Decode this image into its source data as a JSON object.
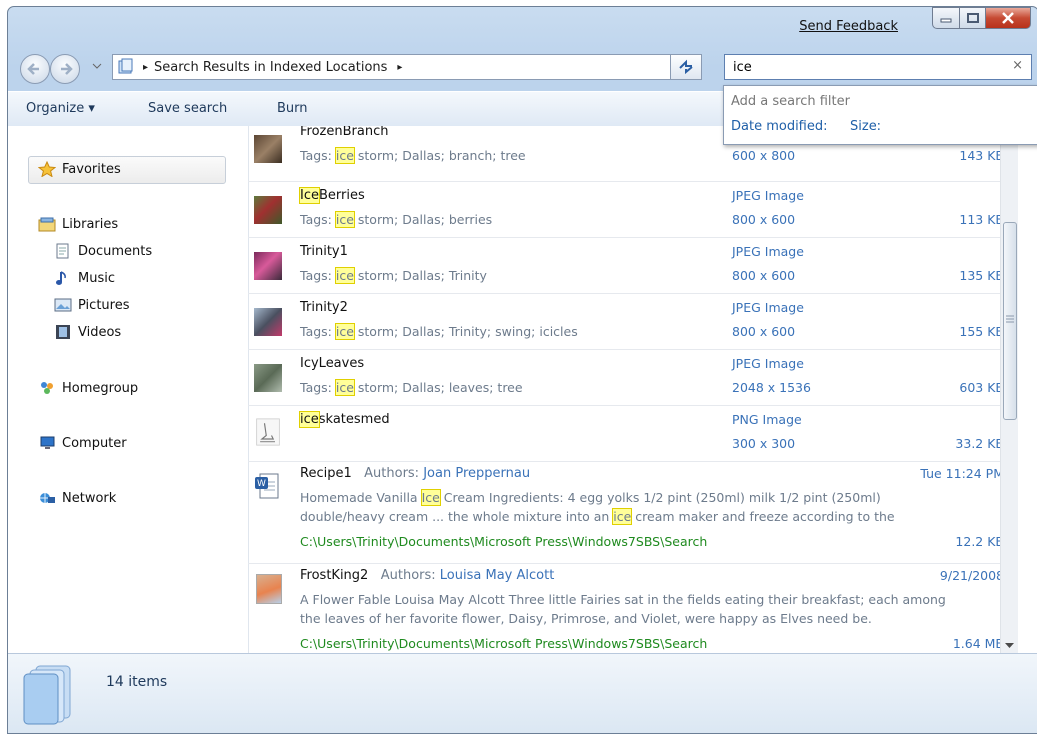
{
  "titlebar": {
    "send_feedback": "Send Feedback",
    "caption_icons": [
      "minimize-icon",
      "maximize-icon",
      "close-icon"
    ]
  },
  "address": {
    "path_parts": [
      "Search Results in Indexed Locations"
    ],
    "separator": "▸",
    "refresh_icon": "refresh-icon"
  },
  "search": {
    "value": "ice",
    "clear": "×"
  },
  "search_dropdown": {
    "heading": "Add a search filter",
    "filters": [
      "Date modified:",
      "Size:"
    ]
  },
  "toolbar": {
    "organize": "Organize ▾",
    "save_search": "Save search",
    "burn": "Burn"
  },
  "nav": {
    "favorites": "Favorites",
    "libraries": "Libraries",
    "documents": "Documents",
    "music": "Music",
    "pictures": "Pictures",
    "videos": "Videos",
    "homegroup": "Homegroup",
    "computer": "Computer",
    "network": "Network"
  },
  "results": {
    "tags_label": "Tags: ",
    "authors_label": "Authors: ",
    "hl_ice_lower": "ice",
    "hl_ice_upper": "Ice",
    "tag_rest": " storm; Dallas; ",
    "files": [
      {
        "name": "FrozenBranch",
        "name_hl": "",
        "name_rest": "FrozenBranch",
        "tags_tail": "branch; tree",
        "type": "JPEG Image",
        "dims": "600 x 800",
        "size": "143 KB"
      },
      {
        "name": "IceBerries",
        "name_hl": "Ice",
        "name_rest": "Berries",
        "tags_tail": "berries",
        "type": "JPEG Image",
        "dims": "800 x 600",
        "size": "113 KB"
      },
      {
        "name": "Trinity1",
        "name_hl": "",
        "name_rest": "Trinity1",
        "tags_tail": "Trinity",
        "type": "JPEG Image",
        "dims": "800 x 600",
        "size": "135 KB"
      },
      {
        "name": "Trinity2",
        "name_hl": "",
        "name_rest": "Trinity2",
        "tags_tail": "Trinity; swing; icicles",
        "type": "JPEG Image",
        "dims": "800 x 600",
        "size": "155 KB"
      },
      {
        "name": "IcyLeaves",
        "name_hl": "",
        "name_rest": "IcyLeaves",
        "tags_tail": "leaves; tree",
        "type": "JPEG Image",
        "dims": "2048 x 1536",
        "size": "603 KB"
      },
      {
        "name": "iceskatesmed",
        "name_hl": "ice",
        "name_rest": "skatesmed",
        "tags_tail": "",
        "type": "PNG Image",
        "dims": "300 x 300",
        "size": "33.2 KB"
      }
    ],
    "docs": [
      {
        "name": "Recipe1",
        "author": "Joan Preppernau",
        "date": "Tue 11:24 PM",
        "snippet1_a": "Homemade Vanilla ",
        "snippet1_hl": "Ice",
        "snippet1_b": " Cream Ingredients: 4 egg yolks 1/2 pint (250ml) milk 1/2 pint (250ml)",
        "snippet2_a": "double/heavy cream ... the whole mixture into an ",
        "snippet2_hl": "ice",
        "snippet2_b": " cream maker and freeze according to the",
        "path": "C:\\Users\\Trinity\\Documents\\Microsoft Press\\Windows7SBS\\Search",
        "size": "12.2 KB"
      },
      {
        "name": "FrostKing2",
        "author": "Louisa May Alcott",
        "date": "9/21/2008",
        "snippet1": "A Flower Fable Louisa May Alcott Three little Fairies sat in the fields eating their breakfast; each among",
        "snippet2": "the leaves of her favorite flower, Daisy, Primrose, and Violet, were happy as Elves need be.",
        "path": "C:\\Users\\Trinity\\Documents\\Microsoft Press\\Windows7SBS\\Search",
        "size": "1.64 MB"
      }
    ]
  },
  "status": {
    "items_count": "14 items"
  }
}
